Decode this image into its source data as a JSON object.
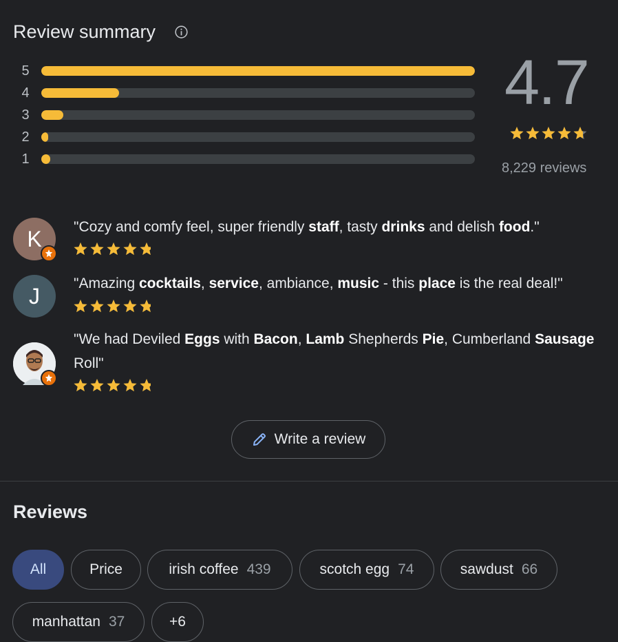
{
  "summary": {
    "title": "Review summary",
    "rating": "4.7",
    "rating_value": 4.7,
    "review_count": "8,229 reviews",
    "accent_color": "#f6bb38",
    "bars": [
      {
        "label": "5",
        "fraction": 1.0
      },
      {
        "label": "4",
        "fraction": 0.18
      },
      {
        "label": "3",
        "fraction": 0.05
      },
      {
        "label": "2",
        "fraction": 0.016
      },
      {
        "label": "1",
        "fraction": 0.02
      }
    ]
  },
  "snippets": [
    {
      "avatar_letter": "K",
      "avatar_color": "#8d6e63",
      "has_badge": true,
      "parts": [
        [
          "\"Cozy and comfy feel, super friendly ",
          false
        ],
        [
          "staff",
          true
        ],
        [
          ", tasty ",
          false
        ],
        [
          "drinks",
          true
        ],
        [
          " and delish ",
          false
        ],
        [
          "food",
          true
        ],
        [
          ".\"",
          false
        ]
      ],
      "stars": 5
    },
    {
      "avatar_letter": "J",
      "avatar_color": "#455a64",
      "has_badge": false,
      "parts": [
        [
          "\"Amazing ",
          false
        ],
        [
          "cocktails",
          true
        ],
        [
          ", ",
          false
        ],
        [
          "service",
          true
        ],
        [
          ", ambiance, ",
          false
        ],
        [
          "music",
          true
        ],
        [
          " - this ",
          false
        ],
        [
          "place",
          true
        ],
        [
          " is the real deal!\"",
          false
        ]
      ],
      "stars": 5
    },
    {
      "avatar_letter": "",
      "avatar_color": "#f1f3f4",
      "has_badge": true,
      "parts": [
        [
          "\"We had Deviled ",
          false
        ],
        [
          "Eggs",
          true
        ],
        [
          " with ",
          false
        ],
        [
          "Bacon",
          true
        ],
        [
          ", ",
          false
        ],
        [
          "Lamb",
          true
        ],
        [
          " Shepherds ",
          false
        ],
        [
          "Pie",
          true
        ],
        [
          ", Cumberland ",
          false
        ],
        [
          "Sausage",
          true
        ],
        [
          " Roll\"",
          false
        ]
      ],
      "stars": 5
    }
  ],
  "write_review": {
    "label": "Write a review",
    "icon": "pencil-icon"
  },
  "reviews": {
    "title": "Reviews",
    "chips": [
      {
        "label": "All",
        "count": "",
        "active": true
      },
      {
        "label": "Price",
        "count": "",
        "active": false
      },
      {
        "label": "irish coffee",
        "count": "439",
        "active": false
      },
      {
        "label": "scotch egg",
        "count": "74",
        "active": false
      },
      {
        "label": "sawdust",
        "count": "66",
        "active": false
      },
      {
        "label": "manhattan",
        "count": "37",
        "active": false
      },
      {
        "label": "+6",
        "count": "",
        "active": false
      }
    ]
  }
}
